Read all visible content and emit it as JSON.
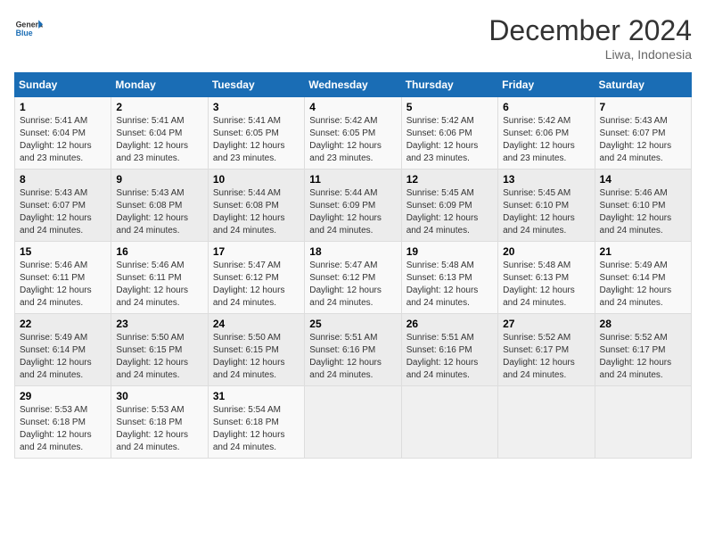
{
  "header": {
    "logo_general": "General",
    "logo_blue": "Blue",
    "month_title": "December 2024",
    "subtitle": "Liwa, Indonesia"
  },
  "weekdays": [
    "Sunday",
    "Monday",
    "Tuesday",
    "Wednesday",
    "Thursday",
    "Friday",
    "Saturday"
  ],
  "weeks": [
    [
      {
        "day": "1",
        "sunrise": "5:41 AM",
        "sunset": "6:04 PM",
        "daylight": "12 hours and 23 minutes."
      },
      {
        "day": "2",
        "sunrise": "5:41 AM",
        "sunset": "6:04 PM",
        "daylight": "12 hours and 23 minutes."
      },
      {
        "day": "3",
        "sunrise": "5:41 AM",
        "sunset": "6:05 PM",
        "daylight": "12 hours and 23 minutes."
      },
      {
        "day": "4",
        "sunrise": "5:42 AM",
        "sunset": "6:05 PM",
        "daylight": "12 hours and 23 minutes."
      },
      {
        "day": "5",
        "sunrise": "5:42 AM",
        "sunset": "6:06 PM",
        "daylight": "12 hours and 23 minutes."
      },
      {
        "day": "6",
        "sunrise": "5:42 AM",
        "sunset": "6:06 PM",
        "daylight": "12 hours and 23 minutes."
      },
      {
        "day": "7",
        "sunrise": "5:43 AM",
        "sunset": "6:07 PM",
        "daylight": "12 hours and 24 minutes."
      }
    ],
    [
      {
        "day": "8",
        "sunrise": "5:43 AM",
        "sunset": "6:07 PM",
        "daylight": "12 hours and 24 minutes."
      },
      {
        "day": "9",
        "sunrise": "5:43 AM",
        "sunset": "6:08 PM",
        "daylight": "12 hours and 24 minutes."
      },
      {
        "day": "10",
        "sunrise": "5:44 AM",
        "sunset": "6:08 PM",
        "daylight": "12 hours and 24 minutes."
      },
      {
        "day": "11",
        "sunrise": "5:44 AM",
        "sunset": "6:09 PM",
        "daylight": "12 hours and 24 minutes."
      },
      {
        "day": "12",
        "sunrise": "5:45 AM",
        "sunset": "6:09 PM",
        "daylight": "12 hours and 24 minutes."
      },
      {
        "day": "13",
        "sunrise": "5:45 AM",
        "sunset": "6:10 PM",
        "daylight": "12 hours and 24 minutes."
      },
      {
        "day": "14",
        "sunrise": "5:46 AM",
        "sunset": "6:10 PM",
        "daylight": "12 hours and 24 minutes."
      }
    ],
    [
      {
        "day": "15",
        "sunrise": "5:46 AM",
        "sunset": "6:11 PM",
        "daylight": "12 hours and 24 minutes."
      },
      {
        "day": "16",
        "sunrise": "5:46 AM",
        "sunset": "6:11 PM",
        "daylight": "12 hours and 24 minutes."
      },
      {
        "day": "17",
        "sunrise": "5:47 AM",
        "sunset": "6:12 PM",
        "daylight": "12 hours and 24 minutes."
      },
      {
        "day": "18",
        "sunrise": "5:47 AM",
        "sunset": "6:12 PM",
        "daylight": "12 hours and 24 minutes."
      },
      {
        "day": "19",
        "sunrise": "5:48 AM",
        "sunset": "6:13 PM",
        "daylight": "12 hours and 24 minutes."
      },
      {
        "day": "20",
        "sunrise": "5:48 AM",
        "sunset": "6:13 PM",
        "daylight": "12 hours and 24 minutes."
      },
      {
        "day": "21",
        "sunrise": "5:49 AM",
        "sunset": "6:14 PM",
        "daylight": "12 hours and 24 minutes."
      }
    ],
    [
      {
        "day": "22",
        "sunrise": "5:49 AM",
        "sunset": "6:14 PM",
        "daylight": "12 hours and 24 minutes."
      },
      {
        "day": "23",
        "sunrise": "5:50 AM",
        "sunset": "6:15 PM",
        "daylight": "12 hours and 24 minutes."
      },
      {
        "day": "24",
        "sunrise": "5:50 AM",
        "sunset": "6:15 PM",
        "daylight": "12 hours and 24 minutes."
      },
      {
        "day": "25",
        "sunrise": "5:51 AM",
        "sunset": "6:16 PM",
        "daylight": "12 hours and 24 minutes."
      },
      {
        "day": "26",
        "sunrise": "5:51 AM",
        "sunset": "6:16 PM",
        "daylight": "12 hours and 24 minutes."
      },
      {
        "day": "27",
        "sunrise": "5:52 AM",
        "sunset": "6:17 PM",
        "daylight": "12 hours and 24 minutes."
      },
      {
        "day": "28",
        "sunrise": "5:52 AM",
        "sunset": "6:17 PM",
        "daylight": "12 hours and 24 minutes."
      }
    ],
    [
      {
        "day": "29",
        "sunrise": "5:53 AM",
        "sunset": "6:18 PM",
        "daylight": "12 hours and 24 minutes."
      },
      {
        "day": "30",
        "sunrise": "5:53 AM",
        "sunset": "6:18 PM",
        "daylight": "12 hours and 24 minutes."
      },
      {
        "day": "31",
        "sunrise": "5:54 AM",
        "sunset": "6:18 PM",
        "daylight": "12 hours and 24 minutes."
      },
      null,
      null,
      null,
      null
    ]
  ]
}
